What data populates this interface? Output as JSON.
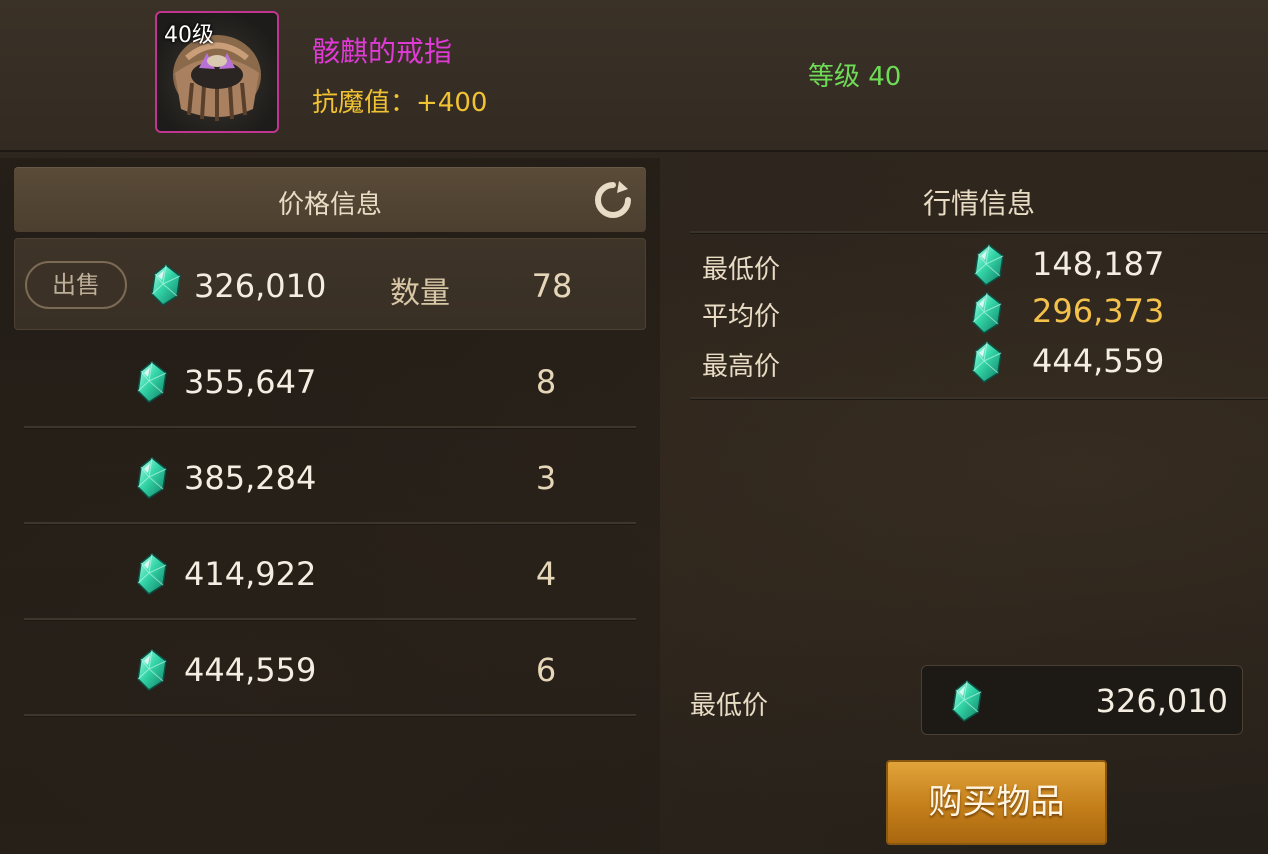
{
  "item": {
    "level_badge": "40级",
    "name": "骸麒的戒指",
    "stat": "抗魔值：+400",
    "requirement": "等级 40",
    "name_color": "#e03ad6",
    "frame_color": "#c0358f"
  },
  "price_info": {
    "title": "价格信息",
    "refresh_icon": "refresh-icon",
    "top_listing": {
      "sell_label": "出售",
      "price": "326,010",
      "qty_label": "数量",
      "qty": "78"
    },
    "listings": [
      {
        "price": "355,647",
        "qty": "8"
      },
      {
        "price": "385,284",
        "qty": "3"
      },
      {
        "price": "414,922",
        "qty": "4"
      },
      {
        "price": "444,559",
        "qty": "6"
      }
    ]
  },
  "market_info": {
    "title": "行情信息",
    "rows": [
      {
        "label": "最低价",
        "value": "148,187"
      },
      {
        "label": "平均价",
        "value": "296,373"
      },
      {
        "label": "最高价",
        "value": "444,559"
      }
    ],
    "avg_color": "#f4c14a"
  },
  "purchase": {
    "min_label": "最低价",
    "min_value": "326,010",
    "buy_label": "购买物品"
  },
  "currency_icon": "diamond-gem-icon"
}
